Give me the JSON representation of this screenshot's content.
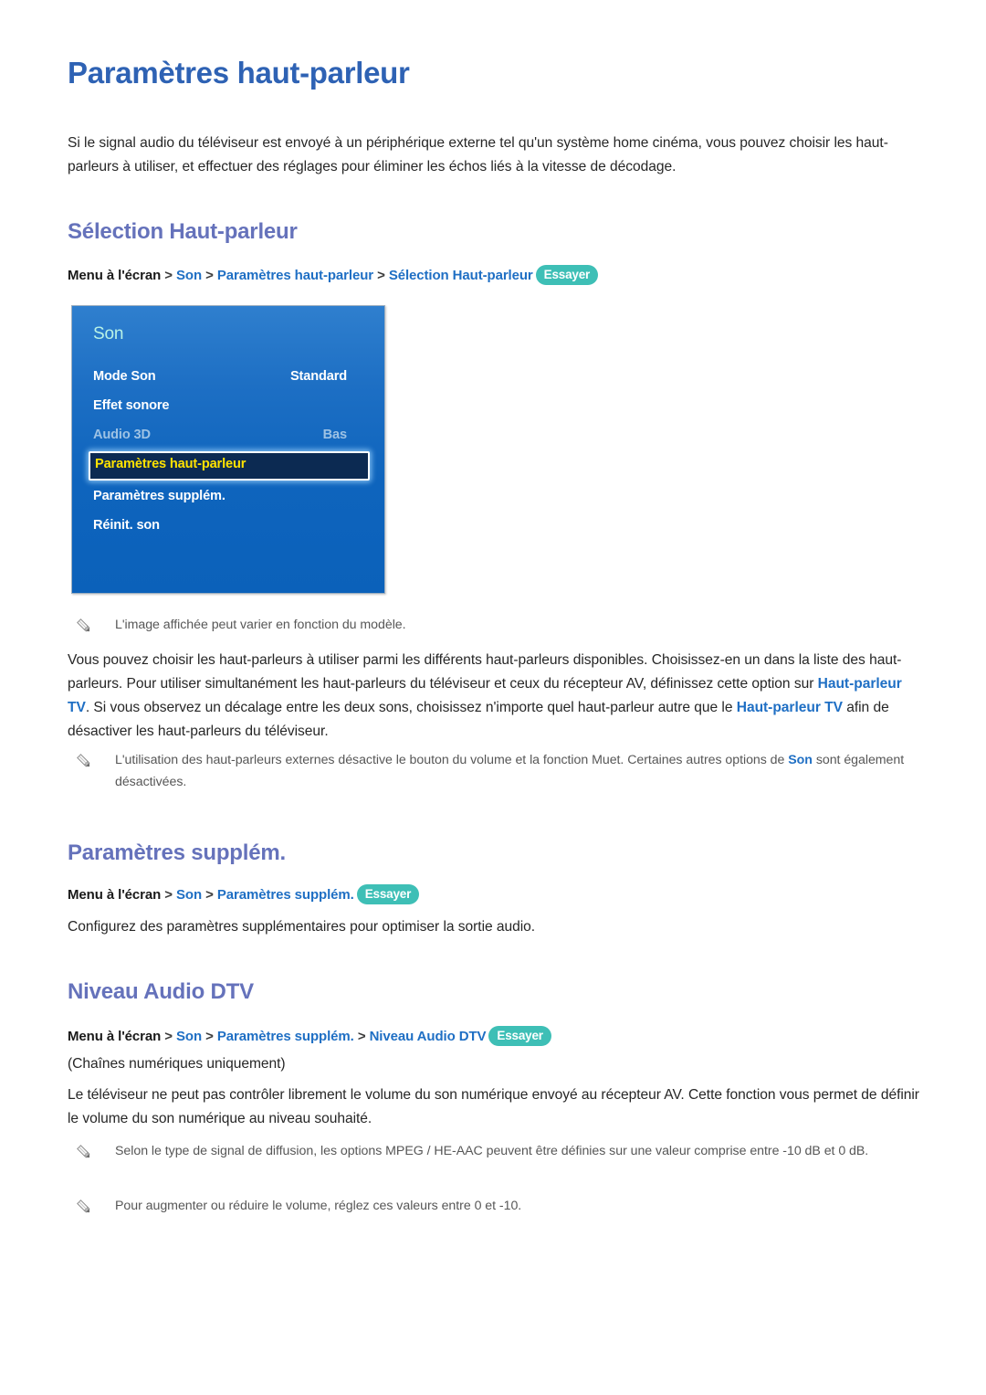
{
  "document": {
    "title": "Paramètres haut-parleur",
    "intro": "Si le signal audio du téléviseur est envoyé à un périphérique externe tel qu'un système home cinéma, vous pouvez choisir les haut-parleurs à utiliser, et effectuer des réglages pour éliminer les échos liés à la vitesse de décodage."
  },
  "colors": {
    "page_title": "#2e62b4",
    "section_title": "#6572bb",
    "link": "#1f6fc4",
    "badge": "#3ebfb6",
    "note_text": "#575757",
    "menu_blue_top": "#2f7fce",
    "menu_blue_bottom": "#0b61ba",
    "menu_selected_bg": "#0c2a52",
    "menu_selected_text": "#ffe200",
    "menu_title": "#b8f2e6"
  },
  "sections": {
    "selection_haut_parleur": {
      "title": "Sélection Haut-parleur",
      "breadcrumb": {
        "root": "Menu à l'écran",
        "sep": ">",
        "items": [
          "Son",
          "Paramètres haut-parleur",
          "Sélection Haut-parleur"
        ],
        "badge": "Essayer"
      },
      "image_note": "L'image affichée peut varier en fonction du modèle.",
      "paragraph_parts": [
        {
          "text": "Vous pouvez choisir les haut-parleurs à utiliser parmi les différents haut-parleurs disponibles. Choisissez-en un dans la liste des haut-parleurs. Pour utiliser simultanément les haut-parleurs du téléviseur et ceux du récepteur AV, définissez cette option sur ",
          "bold": false
        },
        {
          "text": "Haut-parleur TV",
          "bold": true
        },
        {
          "text": ". Si vous observez un décalage entre les deux sons, choisissez n'importe quel haut-parleur autre que le ",
          "bold": false
        },
        {
          "text": "Haut-parleur TV",
          "bold": true
        },
        {
          "text": " afin de désactiver les haut-parleurs du téléviseur.",
          "bold": false
        }
      ],
      "note_parts": [
        {
          "text": "L'utilisation des haut-parleurs externes désactive le bouton du volume et la fonction Muet. Certaines autres options de ",
          "bold": false
        },
        {
          "text": "Son",
          "bold": true
        },
        {
          "text": " sont également désactivées.",
          "bold": false
        }
      ]
    },
    "parametres_supplem": {
      "title": "Paramètres supplém.",
      "breadcrumb": {
        "root": "Menu à l'écran",
        "sep": ">",
        "items": [
          "Son",
          "Paramètres supplém."
        ],
        "badge": "Essayer"
      },
      "paragraph": "Configurez des paramètres supplémentaires pour optimiser la sortie audio."
    },
    "niveau_audio_dtv": {
      "title": "Niveau Audio DTV",
      "breadcrumb": {
        "root": "Menu à l'écran",
        "sep": ">",
        "items": [
          "Son",
          "Paramètres supplém.",
          "Niveau Audio DTV"
        ],
        "badge": "Essayer"
      },
      "subnote": "(Chaînes numériques uniquement)",
      "paragraph": "Le téléviseur ne peut pas contrôler librement le volume du son numérique envoyé au récepteur AV. Cette fonction vous permet de définir le volume du son numérique au niveau souhaité.",
      "notes": [
        "Selon le type de signal de diffusion, les options MPEG / HE-AAC peuvent être définies sur une valeur comprise entre -10 dB et 0 dB.",
        "Pour augmenter ou réduire le volume, réglez ces valeurs entre 0 et -10."
      ]
    }
  },
  "tv_menu": {
    "title": "Son",
    "rows": [
      {
        "label": "Mode Son",
        "value": "Standard",
        "state": "normal"
      },
      {
        "label": "Effet sonore",
        "value": "",
        "state": "normal"
      },
      {
        "label": "Audio 3D",
        "value": "Bas",
        "state": "disabled"
      },
      {
        "label": "Paramètres haut-parleur",
        "value": "",
        "state": "selected"
      },
      {
        "label": "Paramètres supplém.",
        "value": "",
        "state": "normal"
      },
      {
        "label": "Réinit. son",
        "value": "",
        "state": "normal"
      }
    ]
  },
  "icons": {
    "note": "pencil-icon"
  }
}
